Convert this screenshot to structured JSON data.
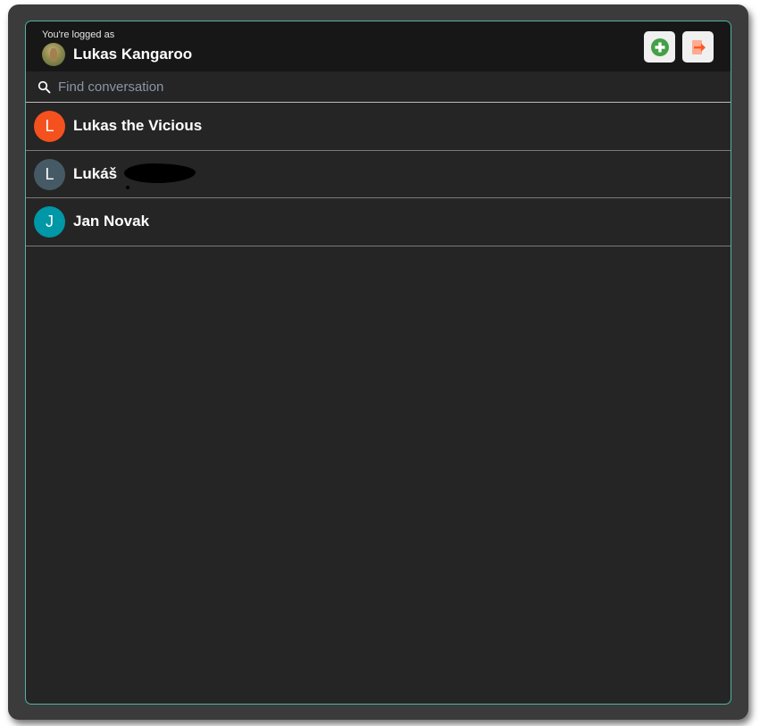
{
  "header": {
    "logged_as_label": "You're logged as",
    "user_name": "Lukas Kangaroo",
    "add_icon": "plus-circle-icon",
    "logout_icon": "logout-icon"
  },
  "search": {
    "placeholder": "Find conversation",
    "value": ""
  },
  "conversations": [
    {
      "initial": "L",
      "name": "Lukas the Vicious",
      "avatar_color": "#f4511e"
    },
    {
      "initial": "L",
      "name": "Lukáš",
      "avatar_color": "#455a64",
      "redacted": true
    },
    {
      "initial": "J",
      "name": "Jan Novak",
      "avatar_color": "#0097a7"
    }
  ],
  "colors": {
    "accent_border": "#4fb3a5",
    "add_green": "#43a047",
    "logout_orange": "#ff5722"
  }
}
